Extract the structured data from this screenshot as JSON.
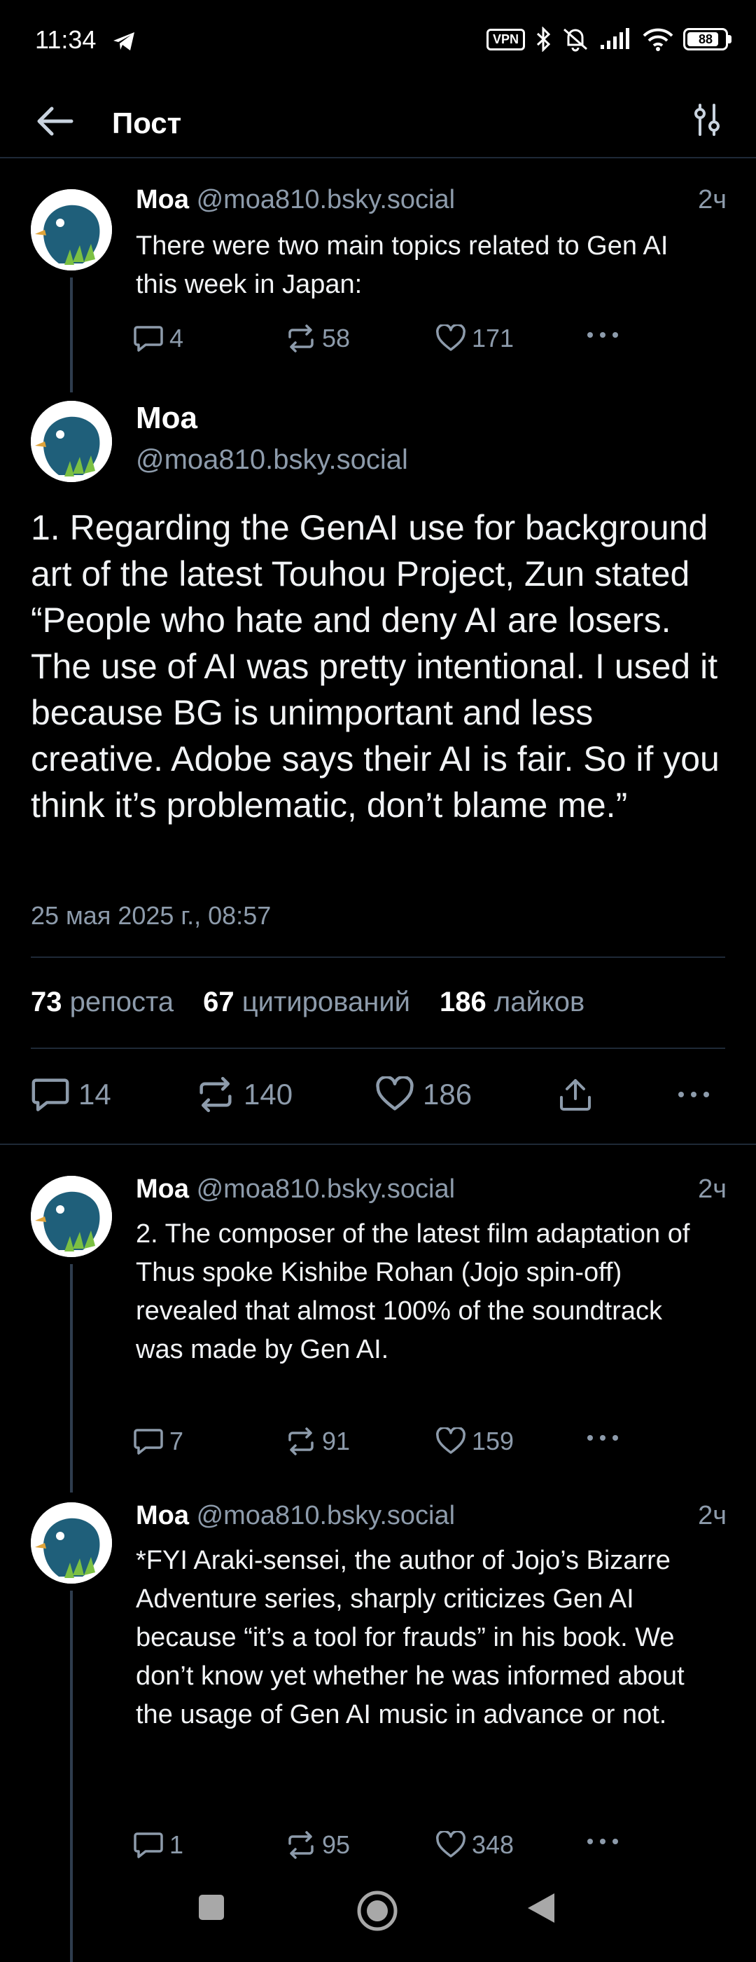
{
  "status_bar": {
    "time": "11:34",
    "vpn": "VPN",
    "battery": "88"
  },
  "header": {
    "title": "Пост"
  },
  "parent_post": {
    "name": "Moa",
    "handle": "@moa810.bsky.social",
    "time": "2ч",
    "text": "There were two main topics related to Gen AI this week in Japan:",
    "replies": "4",
    "reposts": "58",
    "likes": "171"
  },
  "main_post": {
    "name": "Moa",
    "handle": "@moa810.bsky.social",
    "text": "1. Regarding the GenAI use for background art of the latest Touhou Project, Zun stated “People who hate and deny AI are losers. The use of AI was pretty intentional. I used it because BG is unimportant and less creative. Adobe says their AI is fair. So if you think it’s problematic, don’t blame me.”",
    "date": "25 мая 2025 г., 08:57",
    "reposts_count": "73",
    "reposts_label": "репоста",
    "quotes_count": "67",
    "quotes_label": "цитирований",
    "likes_count": "186",
    "likes_label": "лайков",
    "replies": "14",
    "reposts": "140",
    "likes": "186"
  },
  "reply_1": {
    "name": "Moa",
    "handle": "@moa810.bsky.social",
    "time": "2ч",
    "text": "2. The composer of the latest film adaptation of Thus spoke Kishibe Rohan (Jojo spin-off) revealed that almost 100% of the soundtrack was made by Gen AI.",
    "replies": "7",
    "reposts": "91",
    "likes": "159"
  },
  "reply_2": {
    "name": "Moa",
    "handle": "@moa810.bsky.social",
    "time": "2ч",
    "text": "*FYI Araki-sensei, the author of Jojo’s Bizarre Adventure series, sharply criticizes Gen AI because “it’s a tool for frauds” in his book. We don’t know yet whether he was informed about the usage of Gen AI music in advance or not.",
    "replies": "1",
    "reposts": "95",
    "likes": "348"
  },
  "colors": {
    "background": "#000000",
    "muted_text": "#8d9bab",
    "divider": "#1e2937",
    "avatar_bird": "#1f5f7a"
  }
}
